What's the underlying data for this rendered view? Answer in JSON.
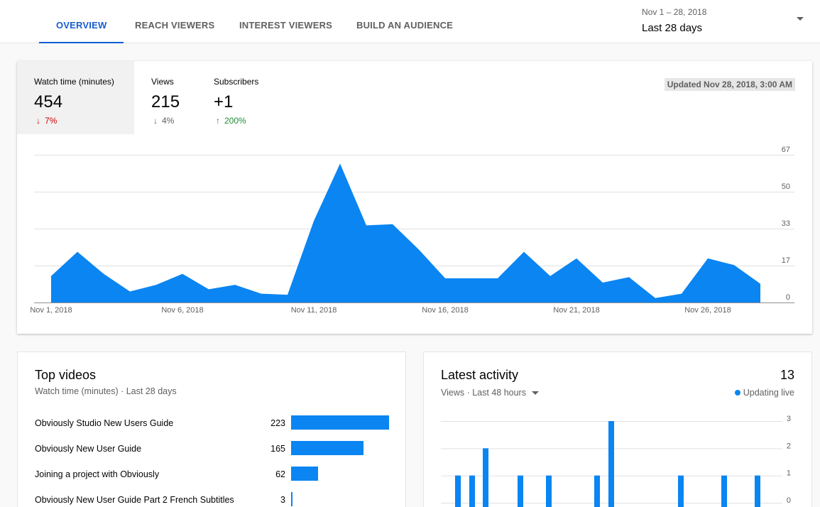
{
  "tabs": [
    {
      "label": "OVERVIEW",
      "active": true
    },
    {
      "label": "REACH VIEWERS",
      "active": false
    },
    {
      "label": "INTEREST VIEWERS",
      "active": false
    },
    {
      "label": "BUILD AN AUDIENCE",
      "active": false
    }
  ],
  "date_picker": {
    "range": "Nov 1 – 28, 2018",
    "label": "Last 28 days"
  },
  "metrics": [
    {
      "label": "Watch time (minutes)",
      "value": "454",
      "change": "7%",
      "direction": "down",
      "color": "#cc0000"
    },
    {
      "label": "Views",
      "value": "215",
      "change": "4%",
      "direction": "down",
      "color": "#606060"
    },
    {
      "label": "Subscribers",
      "value": "+1",
      "change": "200%",
      "direction": "up",
      "color": "#1f8d30"
    }
  ],
  "updated": "Updated Nov 28, 2018, 3:00 AM",
  "accent": "#0a85f2",
  "chart_data": [
    {
      "type": "area",
      "x": [
        "Nov 1",
        "Nov 2",
        "Nov 3",
        "Nov 4",
        "Nov 5",
        "Nov 6",
        "Nov 7",
        "Nov 8",
        "Nov 9",
        "Nov 10",
        "Nov 11",
        "Nov 12",
        "Nov 13",
        "Nov 14",
        "Nov 15",
        "Nov 16",
        "Nov 17",
        "Nov 18",
        "Nov 19",
        "Nov 20",
        "Nov 21",
        "Nov 22",
        "Nov 23",
        "Nov 24",
        "Nov 25",
        "Nov 26",
        "Nov 27",
        "Nov 28"
      ],
      "values": [
        12,
        23,
        13,
        5,
        8,
        13,
        6,
        8,
        4,
        3.5,
        37,
        63,
        35,
        35.5,
        24,
        11,
        11,
        11,
        23,
        12,
        20,
        9,
        11.5,
        2,
        4,
        20,
        17,
        8.5
      ],
      "xticks": [
        "Nov 1, 2018",
        "Nov 6, 2018",
        "Nov 11, 2018",
        "Nov 16, 2018",
        "Nov 21, 2018",
        "Nov 26, 2018"
      ],
      "yticks": [
        "0",
        "17",
        "33",
        "50",
        "67"
      ],
      "ylim": [
        0,
        67
      ]
    },
    {
      "type": "bar",
      "values": [
        0,
        0,
        0,
        0,
        0,
        1,
        0,
        1,
        0,
        2,
        0,
        0,
        0,
        0,
        0,
        1,
        0,
        1,
        0,
        0,
        0,
        1,
        0,
        3,
        0,
        0,
        0,
        0,
        0,
        0,
        0,
        0,
        0,
        0,
        0,
        0,
        0,
        0,
        0,
        0,
        0,
        0,
        0,
        0,
        0,
        0,
        0,
        0
      ],
      "visible_nonzero": [
        [
          1,
          1
        ],
        [
          2,
          1
        ],
        [
          3,
          2
        ],
        [
          6,
          1
        ],
        [
          8,
          1
        ],
        [
          12,
          1
        ],
        [
          13,
          3
        ],
        [
          19,
          1
        ],
        [
          22,
          1
        ],
        [
          24,
          1
        ]
      ],
      "yticks": [
        "0",
        "1",
        "2",
        "3"
      ],
      "ylim": [
        0,
        3
      ]
    }
  ],
  "top_videos": {
    "title": "Top videos",
    "subtitle": "Watch time (minutes) · Last 28 days",
    "items": [
      {
        "title": "Obviously Studio New Users Guide",
        "value": 223
      },
      {
        "title": "Obviously New User Guide",
        "value": 165
      },
      {
        "title": "Joining a project with Obviously",
        "value": 62
      },
      {
        "title": "Obviously New User Guide Part 2 French Subtitles",
        "value": 3
      }
    ],
    "max": 223
  },
  "latest": {
    "title": "Latest activity",
    "count": "13",
    "subtitle": "Views · Last 48 hours",
    "live": "Updating live"
  }
}
